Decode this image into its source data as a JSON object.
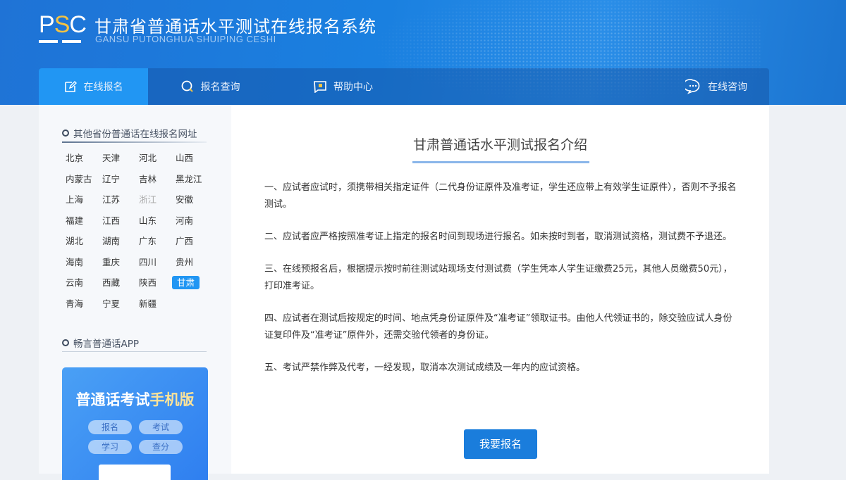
{
  "header": {
    "logo_text": "PSC",
    "title": "甘肃省普通话水平测试在线报名系统",
    "subtitle": "GANSU PUTONGHUA SHUIPING CESHI"
  },
  "nav": {
    "items": [
      {
        "label": "在线报名",
        "icon": "edit-icon"
      },
      {
        "label": "报名查询",
        "icon": "search-icon"
      },
      {
        "label": "帮助中心",
        "icon": "help-icon"
      }
    ],
    "consult": "在线咨询"
  },
  "sidebar": {
    "provinces_title": "其他省份普通话在线报名网址",
    "provinces": [
      "北京",
      "天津",
      "河北",
      "山西",
      "内蒙古",
      "辽宁",
      "吉林",
      "黑龙江",
      "上海",
      "江苏",
      "浙江",
      "安徽",
      "福建",
      "江西",
      "山东",
      "河南",
      "湖北",
      "湖南",
      "广东",
      "广西",
      "海南",
      "重庆",
      "四川",
      "贵州",
      "云南",
      "西藏",
      "陕西",
      "甘肃",
      "青海",
      "宁夏",
      "新疆"
    ],
    "selected": "甘肃",
    "disabled": "浙江",
    "app_title": "畅言普通话APP",
    "app_banner_a": "普通话考试",
    "app_banner_b": "手机版",
    "app_pills": [
      "报名",
      "考试",
      "学习",
      "查分"
    ]
  },
  "main": {
    "title": "甘肃普通话水平测试报名介绍",
    "paragraphs": [
      "一、应试者应试时，须携带相关指定证件（二代身份证原件及准考证，学生还应带上有效学生证原件），否则不予报名测试。",
      "二、应试者应严格按照准考证上指定的报名时间到现场进行报名。如未按时到者，取消测试资格，测试费不予退还。",
      "三、在线预报名后，根据提示按时前往测试站现场支付测试费（学生凭本人学生证缴费25元，其他人员缴费50元），打印准考证。",
      "四、应试者在测试后按规定的时间、地点凭身份证原件及“准考证”领取证书。由他人代领证书的，除交验应试人身份证复印件及“准考证”原件外，还需交验代领者的身份证。",
      "五、考试严禁作弊及代考，一经发现，取消本次测试成绩及一年内的应试资格。"
    ],
    "button": "我要报名"
  },
  "colors": {
    "primary": "#2196f3",
    "button": "#1a7ddc"
  }
}
